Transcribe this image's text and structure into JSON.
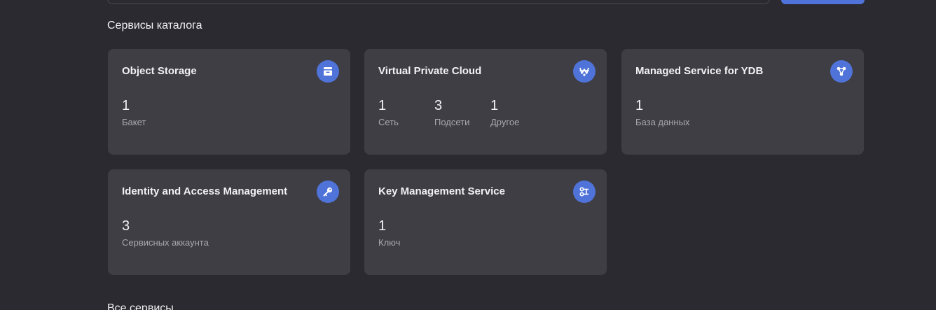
{
  "catalog": {
    "section_title": "Сервисы каталога",
    "cards": [
      {
        "title": "Object Storage",
        "icon": "storage-icon",
        "metrics": [
          {
            "value": "1",
            "label": "Бакет"
          }
        ]
      },
      {
        "title": "Virtual Private Cloud",
        "icon": "network-icon",
        "metrics": [
          {
            "value": "1",
            "label": "Сеть"
          },
          {
            "value": "3",
            "label": "Подсети"
          },
          {
            "value": "1",
            "label": "Другое"
          }
        ]
      },
      {
        "title": "Managed Service for YDB",
        "icon": "database-nodes-icon",
        "metrics": [
          {
            "value": "1",
            "label": "База данных"
          }
        ]
      },
      {
        "title": "Identity and Access Management",
        "icon": "key-icon",
        "metrics": [
          {
            "value": "3",
            "label": "Сервисных аккаунта"
          }
        ]
      },
      {
        "title": "Key Management Service",
        "icon": "kms-key-icon",
        "metrics": [
          {
            "value": "1",
            "label": "Ключ"
          }
        ]
      }
    ]
  },
  "all_services": {
    "section_title": "Все сервисы"
  },
  "colors": {
    "background": "#2b2a30",
    "card": "#3f3e44",
    "accent": "#4f73d9"
  }
}
